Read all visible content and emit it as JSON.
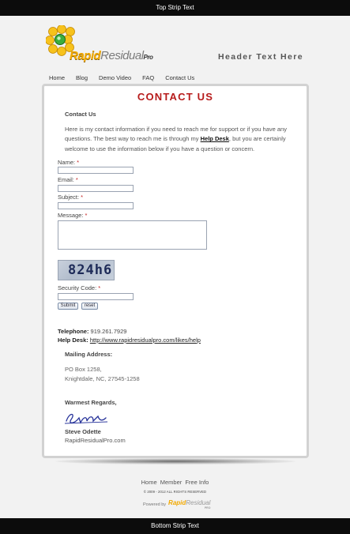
{
  "top_strip": {
    "text": "Top Strip Text"
  },
  "bottom_strip": {
    "text": "Bottom Strip Text"
  },
  "header": {
    "logo": {
      "part1": "Rapid",
      "part2": "Residual",
      "part3": "Pro"
    },
    "text": "Header Text Here"
  },
  "nav": {
    "items": [
      {
        "label": "Home"
      },
      {
        "label": "Blog"
      },
      {
        "label": "Demo Video"
      },
      {
        "label": "FAQ"
      },
      {
        "label": "Contact Us"
      }
    ]
  },
  "page": {
    "title": "CONTACT US",
    "section_heading": "Contact Us",
    "intro_before": "Here is my contact information if you need to reach me for support or if you have any questions. The best way to reach me is through my ",
    "intro_link": "Help Desk",
    "intro_after": ", but you are certainly welcome to use the information below if you have a question or concern."
  },
  "form": {
    "name_label": "Name:",
    "email_label": "Email:",
    "subject_label": "Subject:",
    "message_label": "Message:",
    "required_mark": "*",
    "name_value": "",
    "email_value": "",
    "subject_value": "",
    "message_value": "",
    "captcha_text": "824h6",
    "security_label": "Security Code:",
    "security_value": "",
    "submit_label": "Submit",
    "reset_label": "reset"
  },
  "contact": {
    "telephone_label": "Telephone:",
    "telephone_value": "919.261.7929",
    "helpdesk_label": "Help Desk:",
    "helpdesk_url": "http://www.rapidresidualpro.com/likes/help"
  },
  "mailing": {
    "heading": "Mailing Address:",
    "line1": "PO Box 1258,",
    "line2": "Knightdale, NC, 27545-1258"
  },
  "signoff": {
    "regards": "Warmest Regards,",
    "signature": "Steve Odette",
    "name": "Steve Odette",
    "site": "RapidResidualPro.com"
  },
  "footer": {
    "links": [
      {
        "label": "Home"
      },
      {
        "label": "Member"
      },
      {
        "label": "Free Info"
      }
    ],
    "copyright": "© 2009 - 2012 ALL RIGHTS RESERVED",
    "powered_by": "Powered by",
    "brand_part1": "Rapid",
    "brand_part2": "Residual",
    "brand_part3": "PRO"
  },
  "colors": {
    "strip": "#0c0c0c",
    "title_red": "#b71c1c",
    "logo_gold": "#f2a900",
    "logo_green": "#3cae3c",
    "required_red": "#c21d1d"
  }
}
